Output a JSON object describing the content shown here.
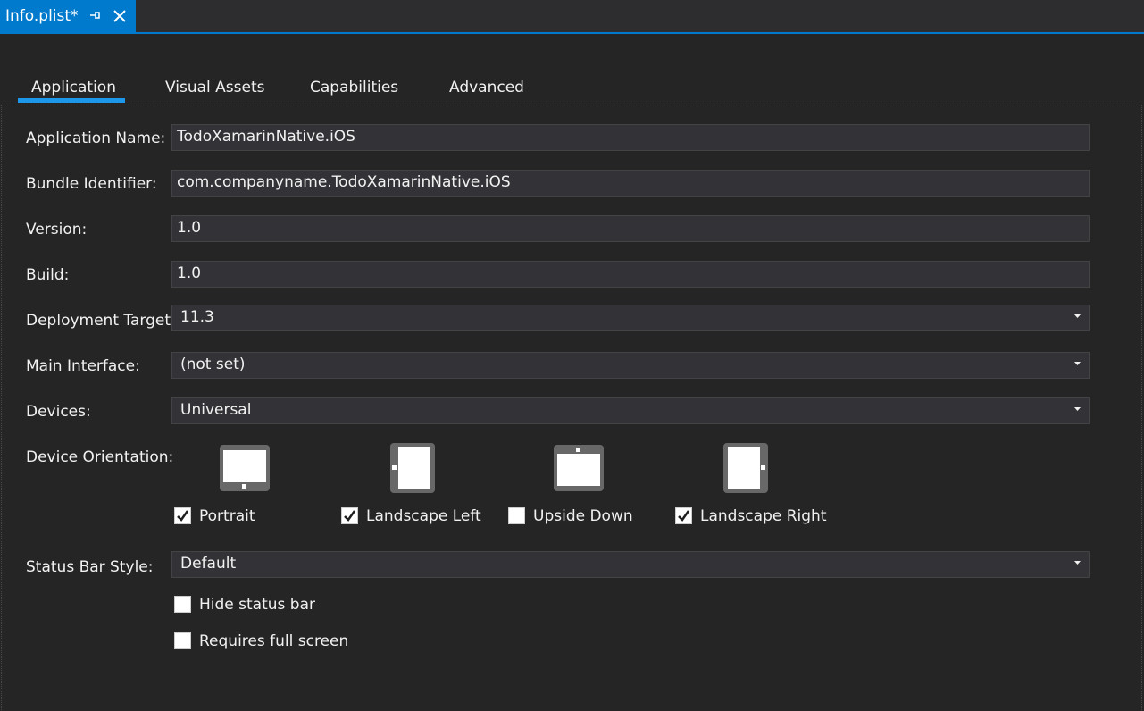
{
  "document_tab": {
    "title": "Info.plist*",
    "pin_icon": "pin-icon",
    "close_icon": "close-icon"
  },
  "tabs": [
    {
      "label": "Application",
      "selected": true
    },
    {
      "label": "Visual Assets",
      "selected": false
    },
    {
      "label": "Capabilities",
      "selected": false
    },
    {
      "label": "Advanced",
      "selected": false
    }
  ],
  "form": {
    "app_name": {
      "label": "Application Name:",
      "value": "TodoXamarinNative.iOS"
    },
    "bundle_id": {
      "label": "Bundle Identifier:",
      "value": "com.companyname.TodoXamarinNative.iOS"
    },
    "version": {
      "label": "Version:",
      "value": "1.0"
    },
    "build": {
      "label": "Build:",
      "value": "1.0"
    },
    "deployment_target": {
      "label": "Deployment Target:",
      "value": "11.3"
    },
    "main_interface": {
      "label": "Main Interface:",
      "value": "(not set)"
    },
    "devices": {
      "label": "Devices:",
      "value": "Universal"
    },
    "device_orientation": {
      "label": "Device Orientation:",
      "options": [
        {
          "label": "Portrait",
          "checked": true
        },
        {
          "label": "Landscape Left",
          "checked": true
        },
        {
          "label": "Upside Down",
          "checked": false
        },
        {
          "label": "Landscape Right",
          "checked": true
        }
      ]
    },
    "status_bar_style": {
      "label": "Status Bar Style:",
      "value": "Default"
    },
    "hide_status_bar": {
      "label": "Hide status bar",
      "checked": false
    },
    "requires_full_screen": {
      "label": "Requires full screen",
      "checked": false
    }
  },
  "colors": {
    "accent": "#007acc",
    "background": "#252526",
    "field_bg": "#333337"
  }
}
